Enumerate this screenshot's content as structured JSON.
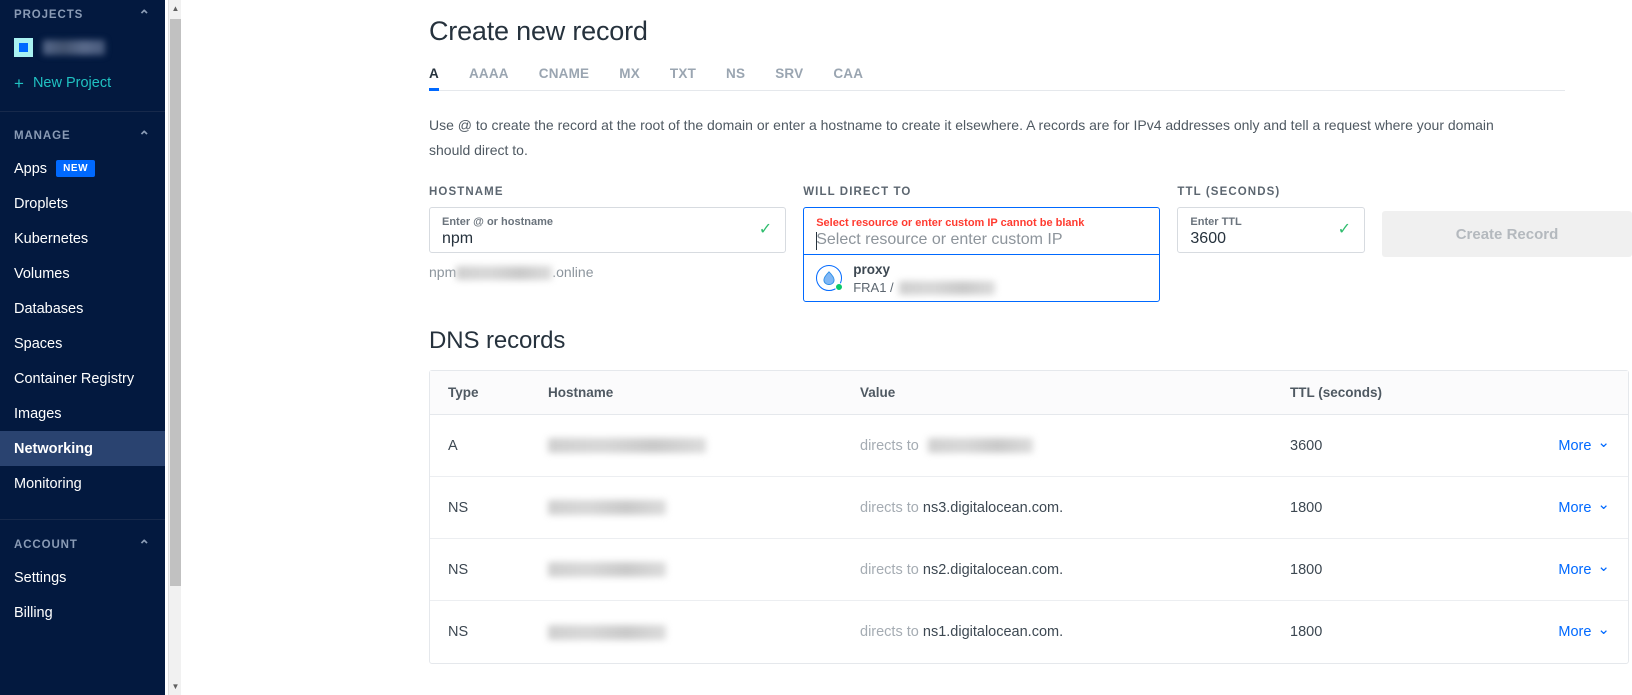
{
  "sidebar": {
    "projects_header": "PROJECTS",
    "project_name_redacted": "",
    "new_project_label": "New Project",
    "manage_header": "MANAGE",
    "manage_items": [
      {
        "label": "Apps",
        "badge": "NEW",
        "active": false
      },
      {
        "label": "Droplets",
        "badge": "",
        "active": false
      },
      {
        "label": "Kubernetes",
        "badge": "",
        "active": false
      },
      {
        "label": "Volumes",
        "badge": "",
        "active": false
      },
      {
        "label": "Databases",
        "badge": "",
        "active": false
      },
      {
        "label": "Spaces",
        "badge": "",
        "active": false
      },
      {
        "label": "Container Registry",
        "badge": "",
        "active": false
      },
      {
        "label": "Images",
        "badge": "",
        "active": false
      },
      {
        "label": "Networking",
        "badge": "",
        "active": true
      },
      {
        "label": "Monitoring",
        "badge": "",
        "active": false
      }
    ],
    "account_header": "ACCOUNT",
    "account_items": [
      {
        "label": "Settings"
      },
      {
        "label": "Billing"
      }
    ]
  },
  "main": {
    "page_title": "Create new record",
    "tabs": [
      {
        "label": "A",
        "active": true
      },
      {
        "label": "AAAA",
        "active": false
      },
      {
        "label": "CNAME",
        "active": false
      },
      {
        "label": "MX",
        "active": false
      },
      {
        "label": "TXT",
        "active": false
      },
      {
        "label": "NS",
        "active": false
      },
      {
        "label": "SRV",
        "active": false
      },
      {
        "label": "CAA",
        "active": false
      }
    ],
    "description": "Use @ to create the record at the root of the domain or enter a hostname to create it elsewhere. A records are for IPv4 addresses only and tell a request where your domain should direct to.",
    "form": {
      "hostname": {
        "label": "HOSTNAME",
        "placeholder": "Enter @ or hostname",
        "value": "npm",
        "valid": true,
        "hint_prefix": "npm",
        "hint_suffix": ".online"
      },
      "will_direct_to": {
        "label": "WILL DIRECT TO",
        "error": "Select resource or enter custom IP cannot be blank",
        "placeholder": "Select resource or enter custom IP",
        "value": "",
        "dropdown_open": true,
        "options": [
          {
            "name": "proxy",
            "region": "FRA1 /",
            "ip_redacted": "",
            "icon": "droplet-icon",
            "status": "online"
          }
        ]
      },
      "ttl": {
        "label": "TTL (SECONDS)",
        "placeholder": "Enter TTL",
        "value": "3600",
        "valid": true
      },
      "create_button": {
        "label": "Create Record",
        "disabled": true
      }
    },
    "records": {
      "title": "DNS records",
      "columns": [
        "Type",
        "Hostname",
        "Value",
        "TTL (seconds)",
        ""
      ],
      "action_label": "More",
      "rows": [
        {
          "type": "A",
          "hostname_redacted": "",
          "value_prefix": "directs to",
          "value": "",
          "value_redacted": true,
          "ttl": "3600",
          "action": "More"
        },
        {
          "type": "NS",
          "hostname_redacted": "",
          "value_prefix": "directs to",
          "value": "ns3.digitalocean.com.",
          "value_redacted": false,
          "ttl": "1800",
          "action": "More"
        },
        {
          "type": "NS",
          "hostname_redacted": "",
          "value_prefix": "directs to",
          "value": "ns2.digitalocean.com.",
          "value_redacted": false,
          "ttl": "1800",
          "action": "More"
        },
        {
          "type": "NS",
          "hostname_redacted": "",
          "value_prefix": "directs to",
          "value": "ns1.digitalocean.com.",
          "value_redacted": false,
          "ttl": "1800",
          "action": "More"
        }
      ]
    }
  },
  "colors": {
    "sidebar_bg": "#03193f",
    "sidebar_active": "#2a4370",
    "accent_blue": "#0069ff",
    "teal": "#20c2c2",
    "error_red": "#ff3b30",
    "success_green": "#2fbd6e",
    "status_green": "#0ac86b"
  }
}
